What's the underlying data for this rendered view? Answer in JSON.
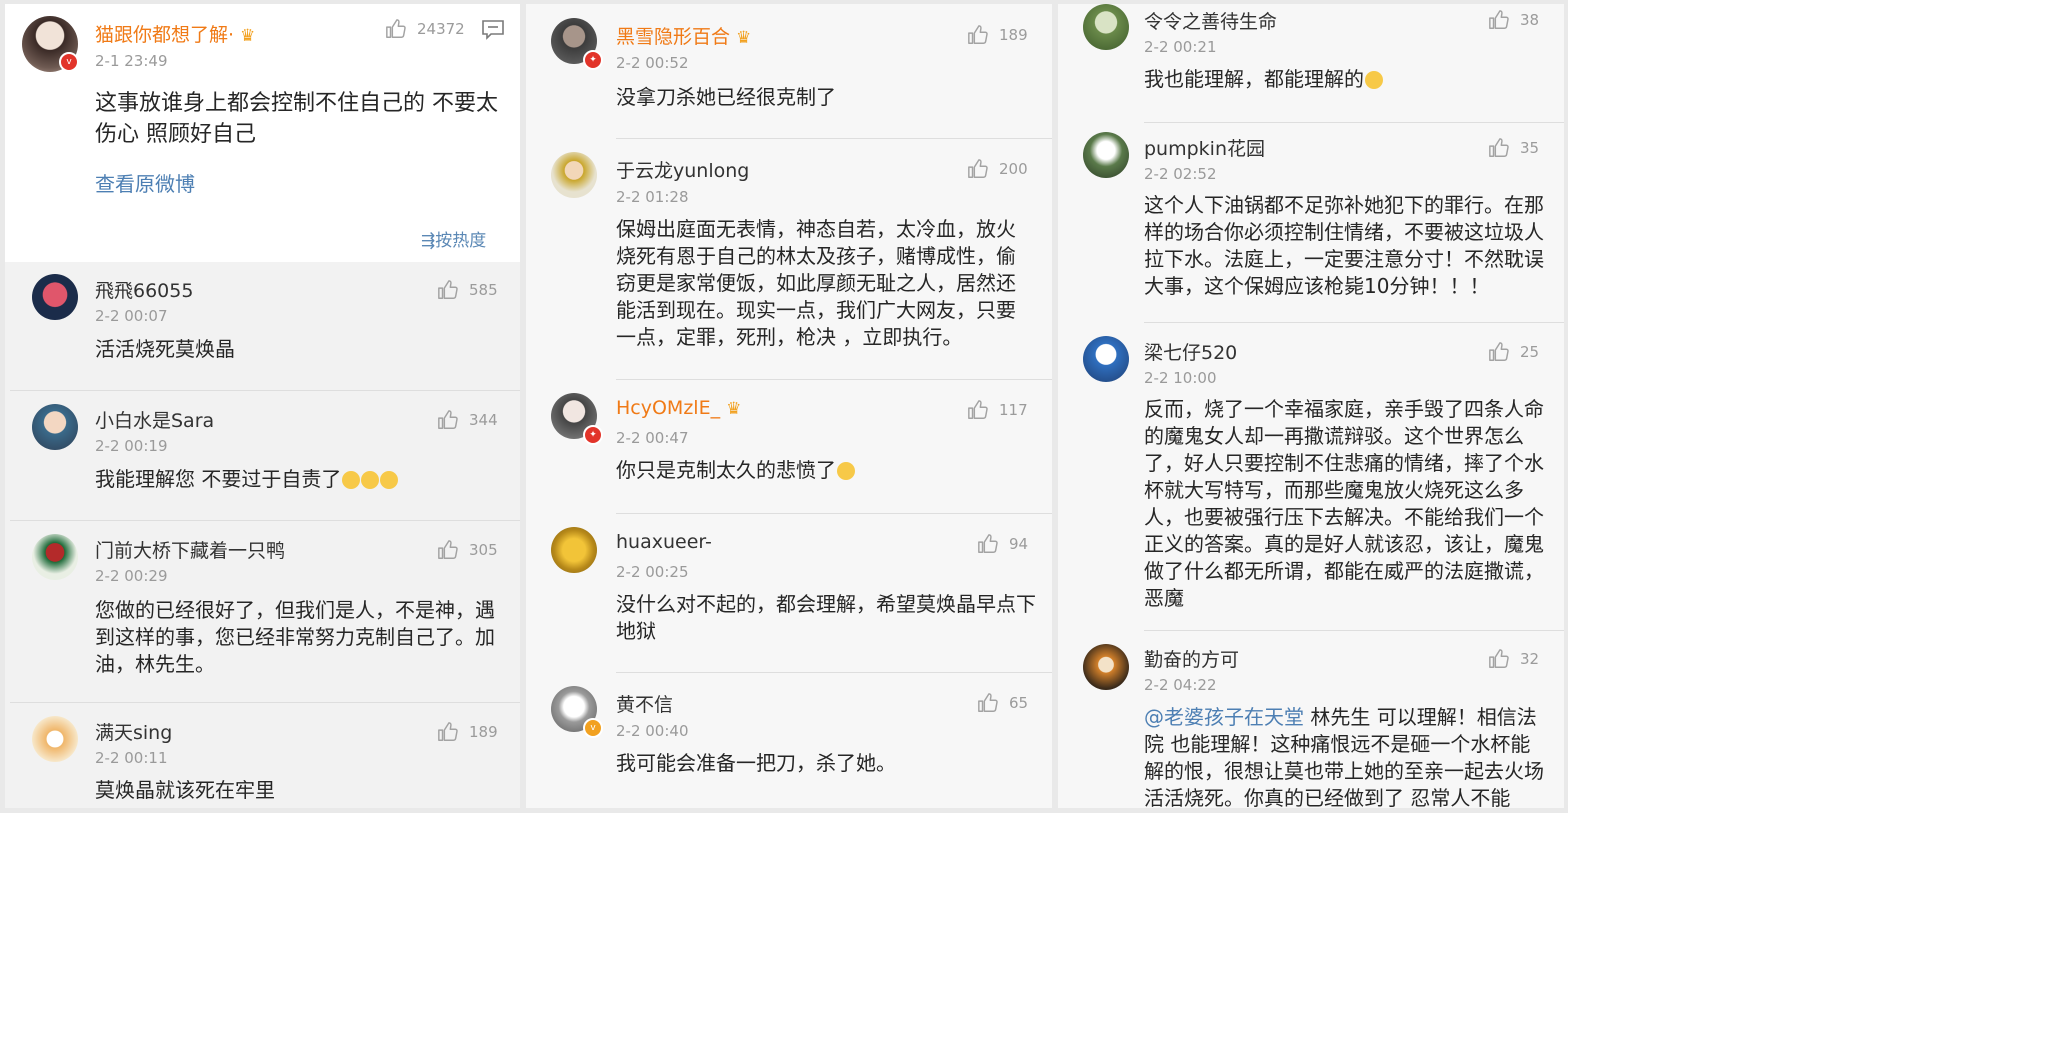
{
  "col1": {
    "lead": {
      "username": "猫跟你都想了解·",
      "time": "2-1 23:49",
      "likes": "24372",
      "text": "这事放谁身上都会控制不住自己的  不要太伤心  照顾好自己",
      "view_original": "查看原微博",
      "sort_label": "按热度"
    },
    "comments": [
      {
        "username": "飛飛66055",
        "time": "2-2 00:07",
        "likes": "585",
        "text": "活活烧死莫焕晶"
      },
      {
        "username": "小白水是Sara",
        "time": "2-2 00:19",
        "likes": "344",
        "text": "我能理解您 不要过于自责了"
      },
      {
        "username": "门前大桥下藏着一只鸭",
        "time": "2-2 00:29",
        "likes": "305",
        "text": "您做的已经很好了，但我们是人，不是神，遇到这样的事，您已经非常努力克制自己了。加油，林先生。"
      },
      {
        "username": "满天sing",
        "time": "2-2 00:11",
        "likes": "189",
        "text": "莫焕晶就该死在牢里"
      }
    ]
  },
  "col2": {
    "comments": [
      {
        "username": "黑雪隐形百合",
        "time": "2-2 00:52",
        "likes": "189",
        "text": "没拿刀杀她已经很克制了"
      },
      {
        "username": "于云龙yunlong",
        "time": "2-2 01:28",
        "likes": "200",
        "text": "保姆出庭面无表情，神态自若，太冷血，放火烧死有恩于自己的林太及孩子，赌博成性，偷窃更是家常便饭，如此厚颜无耻之人，居然还能活到现在。现实一点，我们广大网友，只要一点，定罪，死刑，枪决 ，立即执行。"
      },
      {
        "username": "HcyOMzlE_",
        "time": "2-2 00:47",
        "likes": "117",
        "text": "你只是克制太久的悲愤了"
      },
      {
        "username": "huaxueer-",
        "time": "2-2 00:25",
        "likes": "94",
        "text": "没什么对不起的，都会理解，希望莫焕晶早点下地狱"
      },
      {
        "username": "黄不信",
        "time": "2-2 00:40",
        "likes": "65",
        "text": "我可能会准备一把刀，杀了她。"
      }
    ]
  },
  "col3": {
    "comments": [
      {
        "username": "令令之善待生命",
        "time": "2-2 00:21",
        "likes": "38",
        "text": "我也能理解，都能理解的"
      },
      {
        "username": "pumpkin花园",
        "time": "2-2 02:52",
        "likes": "35",
        "text": "这个人下油锅都不足弥补她犯下的罪行。在那样的场合你必须控制住情绪，不要被这垃圾人拉下水。法庭上，一定要注意分寸！不然耽误大事，这个保姆应该枪毙10分钟！！！"
      },
      {
        "username": "梁七仔520",
        "time": "2-2 10:00",
        "likes": "25",
        "text": "反而，烧了一个幸福家庭，亲手毁了四条人命的魔鬼女人却一再撒谎辩驳。这个世界怎么了，好人只要控制不住悲痛的情绪，摔了个水杯就大写特写，而那些魔鬼放火烧死这么多人，也要被强行压下去解决。不能给我们一个正义的答案。真的是好人就该忍，该让，魔鬼做了什么都无所谓，都能在威严的法庭撒谎，恶魔"
      },
      {
        "username": "勤奋的方可",
        "time": "2-2 04:22",
        "likes": "32",
        "mention": "@老婆孩子在天堂",
        "text": " 林先生  可以理解！相信法院 也能理解！这种痛恨远不是砸一个水杯能解的恨，很想让莫也带上她的至亲一起去火场活活烧死。你真的已经做到了     忍常人不能"
      }
    ]
  },
  "icons": [
    "thumb-up-icon",
    "comment-icon",
    "sort-icon",
    "crown-icon",
    "verified-badge-icon",
    "crying-emoji-icon",
    "sad-emoji-icon"
  ],
  "colors": {
    "link": "#4d7fb3",
    "vip_name": "#f07a16",
    "badge_red": "#e2342a",
    "meta_gray": "#9a9a9a"
  }
}
